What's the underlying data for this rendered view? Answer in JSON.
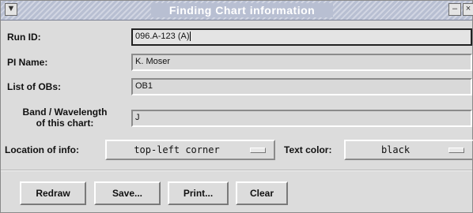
{
  "window": {
    "title": "Finding Chart information"
  },
  "fields": {
    "run_id": {
      "label": "Run ID:",
      "value": "096.A-123 (A)"
    },
    "pi_name": {
      "label": "PI Name:",
      "value": "K. Moser"
    },
    "obs": {
      "label": "List of OBs:",
      "value": "OB1"
    },
    "band": {
      "label_line1": "Band / Wavelength",
      "label_line2": "of this chart:",
      "value": "J"
    }
  },
  "options": {
    "location": {
      "label": "Location of info:",
      "value": "top-left corner"
    },
    "text_color": {
      "label": "Text color:",
      "value": "black"
    }
  },
  "buttons": {
    "redraw": "Redraw",
    "save": "Save...",
    "print": "Print...",
    "clear": "Clear"
  },
  "icons": {
    "window_menu": "chevron-down-icon",
    "minimize": "minimize-icon",
    "close": "close-icon"
  }
}
